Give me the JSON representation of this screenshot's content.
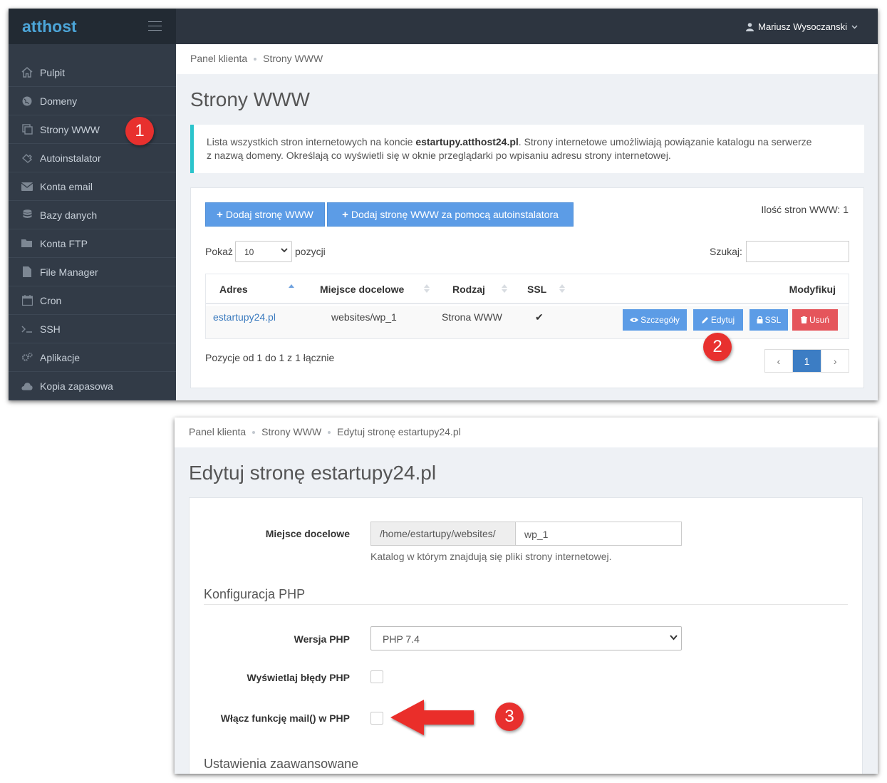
{
  "top": {
    "brand": "atthost",
    "user_name": "Mariusz Wysoczanski",
    "sidebar": [
      {
        "label": "Pulpit",
        "icon": "home-icon"
      },
      {
        "label": "Domeny",
        "icon": "globe-icon"
      },
      {
        "label": "Strony WWW",
        "icon": "pages-icon"
      },
      {
        "label": "Autoinstalator",
        "icon": "puzzle-icon"
      },
      {
        "label": "Konta email",
        "icon": "envelope-icon"
      },
      {
        "label": "Bazy danych",
        "icon": "database-icon"
      },
      {
        "label": "Konta FTP",
        "icon": "folder-icon"
      },
      {
        "label": "File Manager",
        "icon": "file-icon"
      },
      {
        "label": "Cron",
        "icon": "calendar-icon"
      },
      {
        "label": "SSH",
        "icon": "terminal-icon"
      },
      {
        "label": "Aplikacje",
        "icon": "gears-icon"
      },
      {
        "label": "Kopia zapasowa",
        "icon": "cloud-icon"
      }
    ],
    "breadcrumb": [
      "Panel klienta",
      "Strony WWW"
    ],
    "title": "Strony WWW",
    "alert": {
      "before": "Lista wszystkich stron internetowych na koncie ",
      "account": "estartupy.atthost24.pl",
      "after": ". Strony internetowe umożliwiają powiązanie katalogu na serwerze",
      "line2": "z nazwą domeny. Określają co wyświetli się w oknie przeglądarki po wpisaniu adresu strony internetowej."
    },
    "add_button": "Dodaj stronę WWW",
    "add_auto_button": "Dodaj stronę WWW za pomocą autoinstalatora",
    "count_label": "Ilość stron WWW: 1",
    "show_label": "Pokaż",
    "show_value": "10",
    "show_suffix": "pozycji",
    "search_label": "Szukaj:",
    "columns": [
      "Adres",
      "Miejsce docelowe",
      "Rodzaj",
      "SSL",
      "Modyfikuj"
    ],
    "row": {
      "address": "estartupy24.pl",
      "target": "websites/wp_1",
      "type": "Strona WWW",
      "ssl": "✔"
    },
    "actions": [
      "Szczegóły",
      "Edytuj",
      "SSL",
      "Usuń"
    ],
    "info": "Pozycje od 1 do 1 z 1 łącznie",
    "pager": [
      "‹",
      "1",
      "›"
    ]
  },
  "bottom": {
    "breadcrumb": [
      "Panel klienta",
      "Strony WWW",
      "Edytuj stronę estartupy24.pl"
    ],
    "title": "Edytuj stronę estartupy24.pl",
    "target_label": "Miejsce docelowe",
    "target_prefix": "/home/estartupy/websites/",
    "target_value": "wp_1",
    "target_help": "Katalog w którym znajdują się pliki strony internetowej.",
    "php_section": "Konfiguracja PHP",
    "php_version_label": "Wersja PHP",
    "php_version_value": "PHP 7.4",
    "show_errors_label": "Wyświetlaj błędy PHP",
    "mail_label": "Włącz funkcję mail() w PHP",
    "advanced_section": "Ustawienia zaawansowane"
  },
  "annotations": {
    "badge1": "1",
    "badge2": "2",
    "badge3": "3"
  },
  "colors": {
    "accent_blue": "#5c9ce6",
    "danger": "#e5555b",
    "badge_red": "#e8302e",
    "alert_border": "#2bc4cc"
  }
}
